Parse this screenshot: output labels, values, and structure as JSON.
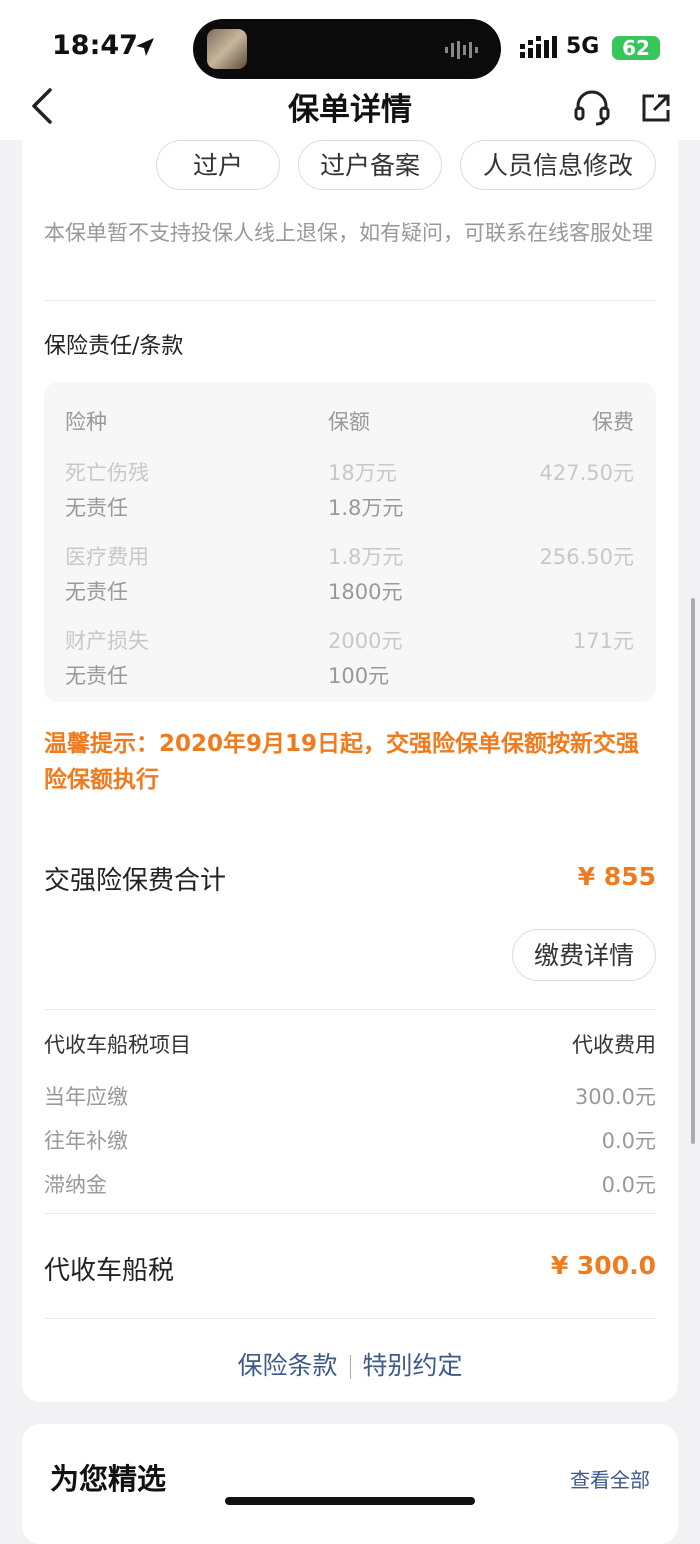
{
  "status": {
    "time": "18:47",
    "network": "5G",
    "battery": "62"
  },
  "header": {
    "title": "保单详情"
  },
  "actions": [
    "过户",
    "过户备案",
    "人员信息修改"
  ],
  "note": "本保单暂不支持投保人线上退保，如有疑问，可联系在线客服处理",
  "coverage": {
    "title": "保险责任/条款",
    "headers": {
      "kind": "险种",
      "amount": "保额",
      "premium": "保费"
    },
    "rows": [
      {
        "kind": "死亡伤残",
        "amount": "18万元",
        "premium": "427.50元",
        "sub_kind": "无责任",
        "sub_amount": "1.8万元"
      },
      {
        "kind": "医疗费用",
        "amount": "1.8万元",
        "premium": "256.50元",
        "sub_kind": "无责任",
        "sub_amount": "1800元"
      },
      {
        "kind": "财产损失",
        "amount": "2000元",
        "premium": "171元",
        "sub_kind": "无责任",
        "sub_amount": "100元"
      }
    ]
  },
  "warning": "温馨提示：2020年9月19日起，交强险保单保额按新交强险保额执行",
  "total": {
    "label": "交强险保费合计",
    "amount": "¥ 855"
  },
  "pay_detail_button": "缴费详情",
  "tax": {
    "headers": {
      "item": "代收车船税项目",
      "fee": "代收费用"
    },
    "rows": [
      {
        "item": "当年应缴",
        "fee": "300.0元"
      },
      {
        "item": "往年补缴",
        "fee": "0.0元"
      },
      {
        "item": "滞纳金",
        "fee": "0.0元"
      }
    ],
    "total_label": "代收车船税",
    "total_amount": "¥ 300.0"
  },
  "links": {
    "terms": "保险条款",
    "special": "特别约定"
  },
  "recommend": {
    "title": "为您精选",
    "see_all": "查看全部"
  },
  "colors": {
    "accent": "#f07b1f",
    "link": "#3d5a8a"
  }
}
